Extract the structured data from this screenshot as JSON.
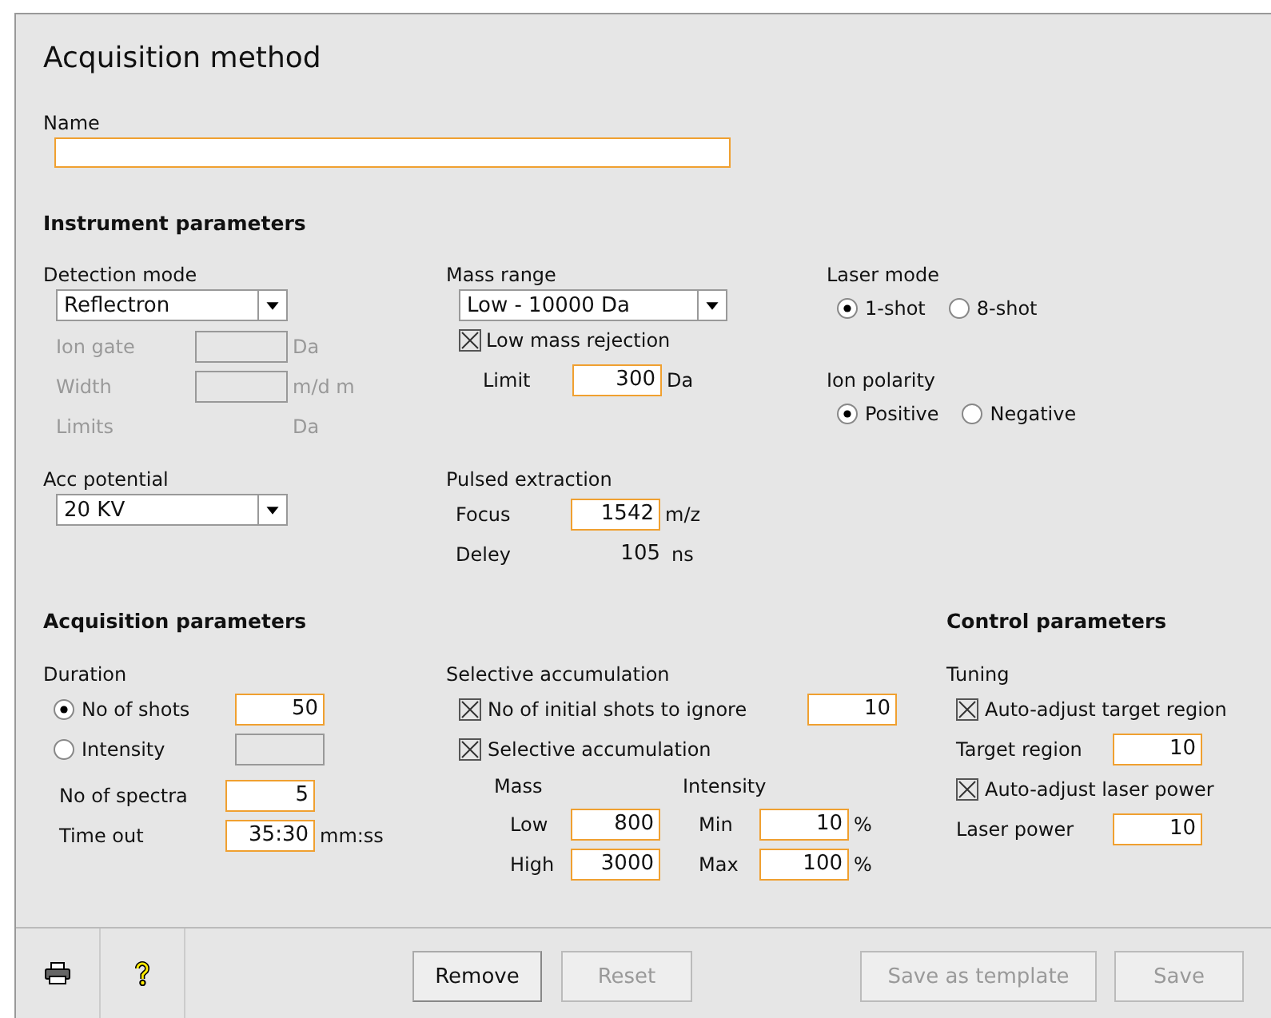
{
  "title": "Acquisition method",
  "name_field": {
    "label": "Name"
  },
  "instrument": {
    "heading": "Instrument parameters",
    "detection": {
      "label": "Detection mode",
      "value": "Reflectron",
      "rows": [
        {
          "kind": "field",
          "label": "Ion gate",
          "unit": "Da",
          "disabled": true
        },
        {
          "kind": "field",
          "label": "Width",
          "unit": "m/d m",
          "disabled": true
        },
        {
          "kind": "text",
          "label": "Limits",
          "unit": "Da",
          "disabled": true
        }
      ]
    },
    "acc": {
      "label": "Acc potential",
      "value": "20 KV"
    },
    "mass_range": {
      "label": "Mass range",
      "value": "Low - 10000 Da",
      "rejection": {
        "label": "Low mass rejection",
        "checked": true
      },
      "limit": {
        "label": "Limit",
        "value": "300",
        "unit": "Da"
      }
    },
    "pulsed": {
      "label": "Pulsed extraction",
      "focus": {
        "label": "Focus",
        "value": "1542",
        "unit": "m/z"
      },
      "delay": {
        "label": "Deley",
        "value": "105",
        "unit": "ns"
      }
    },
    "laser_mode": {
      "label": "Laser mode",
      "options": [
        {
          "label": "1-shot",
          "selected": true
        },
        {
          "label": "8-shot",
          "selected": false
        }
      ]
    },
    "ion_polarity": {
      "label": "Ion polarity",
      "options": [
        {
          "label": "Positive",
          "selected": true
        },
        {
          "label": "Negative",
          "selected": false
        }
      ]
    }
  },
  "acquisition": {
    "heading": "Acquisition parameters",
    "duration": {
      "label": "Duration",
      "options": [
        {
          "label": "No of shots",
          "selected": true,
          "value": "50"
        },
        {
          "label": "Intensity",
          "selected": false
        }
      ]
    },
    "spectra": {
      "label": "No of spectra",
      "value": "5"
    },
    "timeout": {
      "label": "Time out",
      "value": "35:30",
      "unit": "mm:ss"
    },
    "selective": {
      "label": "Selective accumulation",
      "ignore": {
        "label": "No of initial shots to ignore",
        "checked": true,
        "value": "10"
      },
      "accumulate": {
        "label": "Selective accumulation",
        "checked": true
      },
      "mass": {
        "label": "Mass",
        "rows": [
          {
            "label": "Low",
            "value": "800"
          },
          {
            "label": "High",
            "value": "3000"
          }
        ]
      },
      "intensity": {
        "label": "Intensity",
        "rows": [
          {
            "label": "Min",
            "value": "10",
            "unit": "%"
          },
          {
            "label": "Max",
            "value": "100",
            "unit": "%"
          }
        ]
      }
    }
  },
  "control": {
    "heading": "Control parameters",
    "tuning": "Tuning",
    "items": [
      {
        "kind": "check",
        "label": "Auto-adjust target region",
        "checked": true
      },
      {
        "kind": "field",
        "label": "Target region",
        "value": "10"
      },
      {
        "kind": "check",
        "label": "Auto-adjust laser power",
        "checked": true
      },
      {
        "kind": "field",
        "label": "Laser power",
        "value": "10"
      }
    ]
  },
  "buttons": [
    {
      "label": "Remove",
      "disabled": false
    },
    {
      "label": "Reset",
      "disabled": true
    },
    {
      "label": "Save as template",
      "disabled": true
    },
    {
      "label": "Save",
      "disabled": true
    }
  ]
}
